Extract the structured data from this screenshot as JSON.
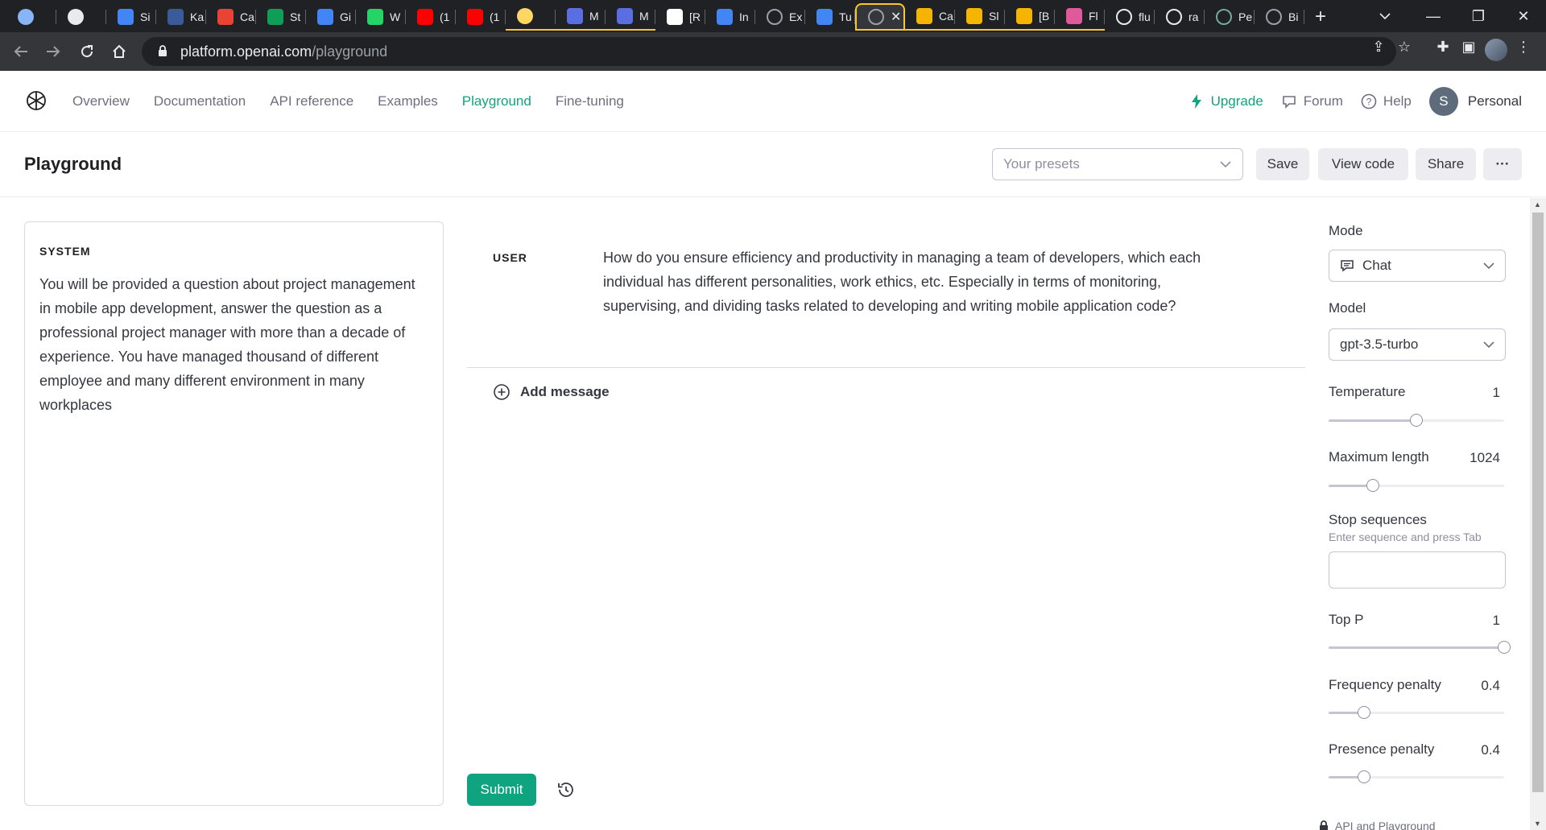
{
  "browser": {
    "tabs": [
      {
        "title": "",
        "icon": "circle-icon",
        "color": "#8ab4f8"
      },
      {
        "title": "",
        "icon": "circle-icon",
        "color": "#e8eaed"
      },
      {
        "title": "Si",
        "icon": "chrome-icon",
        "color": "#4285f4"
      },
      {
        "title": "Ka",
        "icon": "flag-icon",
        "color": "#3c5a99"
      },
      {
        "title": "Ca",
        "icon": "gmail-icon",
        "color": "#ea4335"
      },
      {
        "title": "St",
        "icon": "sheets-icon",
        "color": "#0f9d58"
      },
      {
        "title": "Gi",
        "icon": "docs-icon",
        "color": "#4285f4"
      },
      {
        "title": "W",
        "icon": "whatsapp-icon",
        "color": "#25d366"
      },
      {
        "title": "(1",
        "icon": "youtube-icon",
        "color": "#ff0000"
      },
      {
        "title": "(1",
        "icon": "youtube-icon",
        "color": "#ff0000"
      },
      {
        "title": "",
        "icon": "circle-icon",
        "color": "#fdd663"
      },
      {
        "title": "M",
        "icon": "wave-icon",
        "color": "#5b6ee1"
      },
      {
        "title": "M",
        "icon": "wave-icon",
        "color": "#5b6ee1"
      },
      {
        "title": "[R",
        "icon": "notion-icon",
        "color": "#ffffff"
      },
      {
        "title": "In",
        "icon": "docs-icon",
        "color": "#4285f4"
      },
      {
        "title": "Ex",
        "icon": "openai-icon",
        "color": "#9aa0a6"
      },
      {
        "title": "Tu",
        "icon": "docs-icon",
        "color": "#4285f4"
      },
      {
        "title": "",
        "icon": "openai-icon",
        "color": "#9aa0a6",
        "active": true
      },
      {
        "title": "Ca",
        "icon": "house-icon",
        "color": "#f4b400"
      },
      {
        "title": "Sl",
        "icon": "slides-icon",
        "color": "#f4b400"
      },
      {
        "title": "[B",
        "icon": "slides-icon",
        "color": "#f4b400"
      },
      {
        "title": "Fl",
        "icon": "trello-icon",
        "color": "#e05a9b"
      },
      {
        "title": "flu",
        "icon": "github-icon",
        "color": "#e8eaed"
      },
      {
        "title": "ra",
        "icon": "github-icon",
        "color": "#e8eaed"
      },
      {
        "title": "Pe",
        "icon": "openai-icon",
        "color": "#74aa9c"
      },
      {
        "title": "Bi",
        "icon": "openai-icon",
        "color": "#9aa0a6"
      }
    ],
    "url_host": "platform.openai.com",
    "url_path": "/playground"
  },
  "nav": {
    "overview": "Overview",
    "documentation": "Documentation",
    "api_reference": "API reference",
    "examples": "Examples",
    "playground": "Playground",
    "fine_tuning": "Fine-tuning"
  },
  "header_right": {
    "upgrade": "Upgrade",
    "forum": "Forum",
    "help": "Help",
    "avatar_initial": "S",
    "account": "Personal"
  },
  "page": {
    "title": "Playground",
    "presets_placeholder": "Your presets",
    "save": "Save",
    "view_code": "View code",
    "share": "Share",
    "more": "···"
  },
  "system": {
    "label": "SYSTEM",
    "text": "You will be provided a question about project management in mobile app development, answer the question as a professional project manager with more than a decade of experience. You have managed thousand of different employee and many different environment in many workplaces"
  },
  "messages": [
    {
      "role": "USER",
      "text": "How do you ensure efficiency and productivity in managing a team of developers, which each individual has different personalities, work ethics, etc. Especially in terms of monitoring, supervising, and dividing tasks related to developing and writing mobile application code?"
    }
  ],
  "add_message": "Add message",
  "submit": "Submit",
  "settings": {
    "mode_label": "Mode",
    "mode_value": "Chat",
    "model_label": "Model",
    "model_value": "gpt-3.5-turbo",
    "temperature_label": "Temperature",
    "temperature_value": "1",
    "temperature_fraction": 0.5,
    "max_length_label": "Maximum length",
    "max_length_value": "1024",
    "max_length_fraction": 0.25,
    "stop_label": "Stop sequences",
    "stop_hint": "Enter sequence and press Tab",
    "top_p_label": "Top P",
    "top_p_value": "1",
    "top_p_fraction": 1.0,
    "freq_label": "Frequency penalty",
    "freq_value": "0.4",
    "freq_fraction": 0.2,
    "presence_label": "Presence penalty",
    "presence_value": "0.4",
    "presence_fraction": 0.2,
    "footer": "API and Playground"
  },
  "colors": {
    "accent": "#10a37f",
    "tab_group": "#f9c72e"
  }
}
